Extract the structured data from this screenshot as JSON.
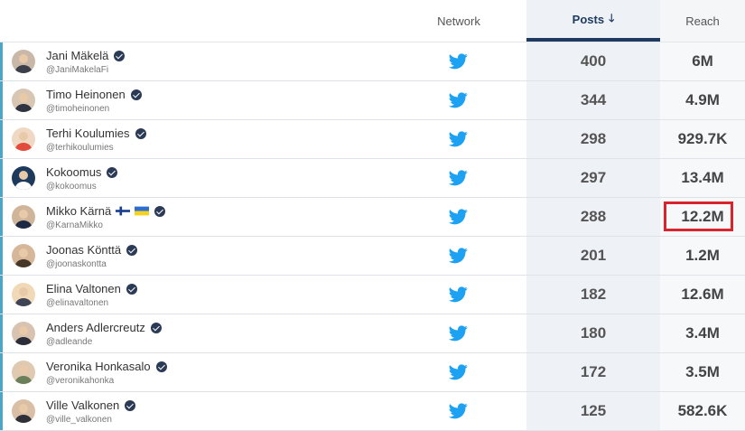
{
  "header": {
    "network_label": "Network",
    "posts_label": "Posts",
    "posts_sort_icon": "arrow-down-icon",
    "reach_label": "Reach"
  },
  "colors": {
    "accent_bar": "#4aa6c8",
    "twitter_blue": "#1da1f2",
    "sorted_column_border": "#1f3a5f",
    "highlight_border": "#d9232d"
  },
  "network_icon": "twitter-icon",
  "rows": [
    {
      "name": "Jani Mäkelä",
      "handle": "@JaniMakelaFi",
      "posts": "400",
      "reach": "6M",
      "verified": true
    },
    {
      "name": "Timo Heinonen",
      "handle": "@timoheinonen",
      "posts": "344",
      "reach": "4.9M",
      "verified": true
    },
    {
      "name": "Terhi Koulumies",
      "handle": "@terhikoulumies",
      "posts": "298",
      "reach": "929.7K",
      "verified": true
    },
    {
      "name": "Kokoomus",
      "handle": "@kokoomus",
      "posts": "297",
      "reach": "13.4M",
      "verified": true
    },
    {
      "name": "Mikko Kärnä",
      "handle": "@KarnaMikko",
      "posts": "288",
      "reach": "12.2M",
      "verified": true,
      "flags": [
        "finland-flag-icon",
        "ukraine-flag-icon"
      ],
      "reach_highlighted": true
    },
    {
      "name": "Joonas Könttä",
      "handle": "@joonaskontta",
      "posts": "201",
      "reach": "1.2M",
      "verified": true
    },
    {
      "name": "Elina Valtonen",
      "handle": "@elinavaltonen",
      "posts": "182",
      "reach": "12.6M",
      "verified": true
    },
    {
      "name": "Anders Adlercreutz",
      "handle": "@adleande",
      "posts": "180",
      "reach": "3.4M",
      "verified": true
    },
    {
      "name": "Veronika Honkasalo",
      "handle": "@veronikahonka",
      "posts": "172",
      "reach": "3.5M",
      "verified": true
    },
    {
      "name": "Ville Valkonen",
      "handle": "@ville_valkonen",
      "posts": "125",
      "reach": "582.6K",
      "verified": true
    }
  ]
}
